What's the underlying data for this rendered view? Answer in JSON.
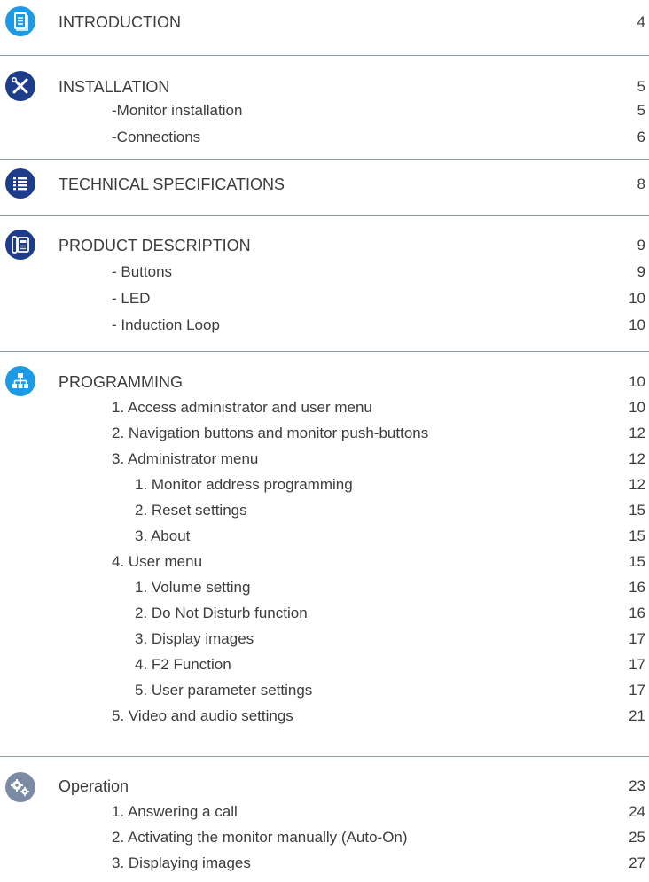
{
  "colors": {
    "icon_light_blue": "#1c9ae6",
    "icon_navy": "#1d3d8c",
    "icon_grey": "#7b8ba3",
    "divider": "#8a9db5",
    "text": "#3c3c3c"
  },
  "sections": [
    {
      "icon": "document-icon",
      "title": "INTRODUCTION",
      "page": "4",
      "items": []
    },
    {
      "icon": "tools-icon",
      "title": "INSTALLATION",
      "page": "5",
      "items": [
        {
          "label": "-Monitor installation",
          "page": "5"
        },
        {
          "label": "-Connections",
          "page": "6"
        }
      ]
    },
    {
      "icon": "list-icon",
      "title": "TECHNICAL SPECIFICATIONS",
      "page": "8",
      "items": []
    },
    {
      "icon": "monitor-phone-icon",
      "title": "PRODUCT DESCRIPTION",
      "page": "9",
      "items": [
        {
          "label": "- Buttons",
          "page": "9"
        },
        {
          "label": "- LED",
          "page": "10"
        },
        {
          "label": "- Induction Loop",
          "page": "10"
        }
      ]
    },
    {
      "icon": "network-icon",
      "title": "PROGRAMMING",
      "page": "10",
      "items": [
        {
          "label": "1. Access administrator and user menu",
          "page": "10"
        },
        {
          "label": "2. Navigation buttons and monitor push-buttons",
          "page": "12"
        },
        {
          "label": "3. Administrator menu",
          "page": "12"
        },
        {
          "label": "1. Monitor address programming",
          "page": "12",
          "sub": true
        },
        {
          "label": "2. Reset settings",
          "page": "15",
          "sub": true
        },
        {
          "label": "3. About",
          "page": "15",
          "sub": true
        },
        {
          "label": "4. User menu",
          "page": "15"
        },
        {
          "label": "1. Volume setting",
          "page": "16",
          "sub": true
        },
        {
          "label": "2. Do Not Disturb function",
          "page": "16",
          "sub": true
        },
        {
          "label": "3. Display images",
          "page": "17",
          "sub": true
        },
        {
          "label": "4. F2 Function",
          "page": "17",
          "sub": true
        },
        {
          "label": "5. User parameter settings",
          "page": "17",
          "sub": true
        },
        {
          "label": "5. Video and audio settings",
          "page": "21"
        }
      ]
    },
    {
      "icon": "gears-icon",
      "title": "Operation",
      "page": "23",
      "items": [
        {
          "label": "1. Answering a call",
          "page": "24"
        },
        {
          "label": "2. Activating the monitor manually (Auto-On)",
          "page": "25"
        },
        {
          "label": "3. Displaying images",
          "page": "27"
        }
      ]
    }
  ]
}
